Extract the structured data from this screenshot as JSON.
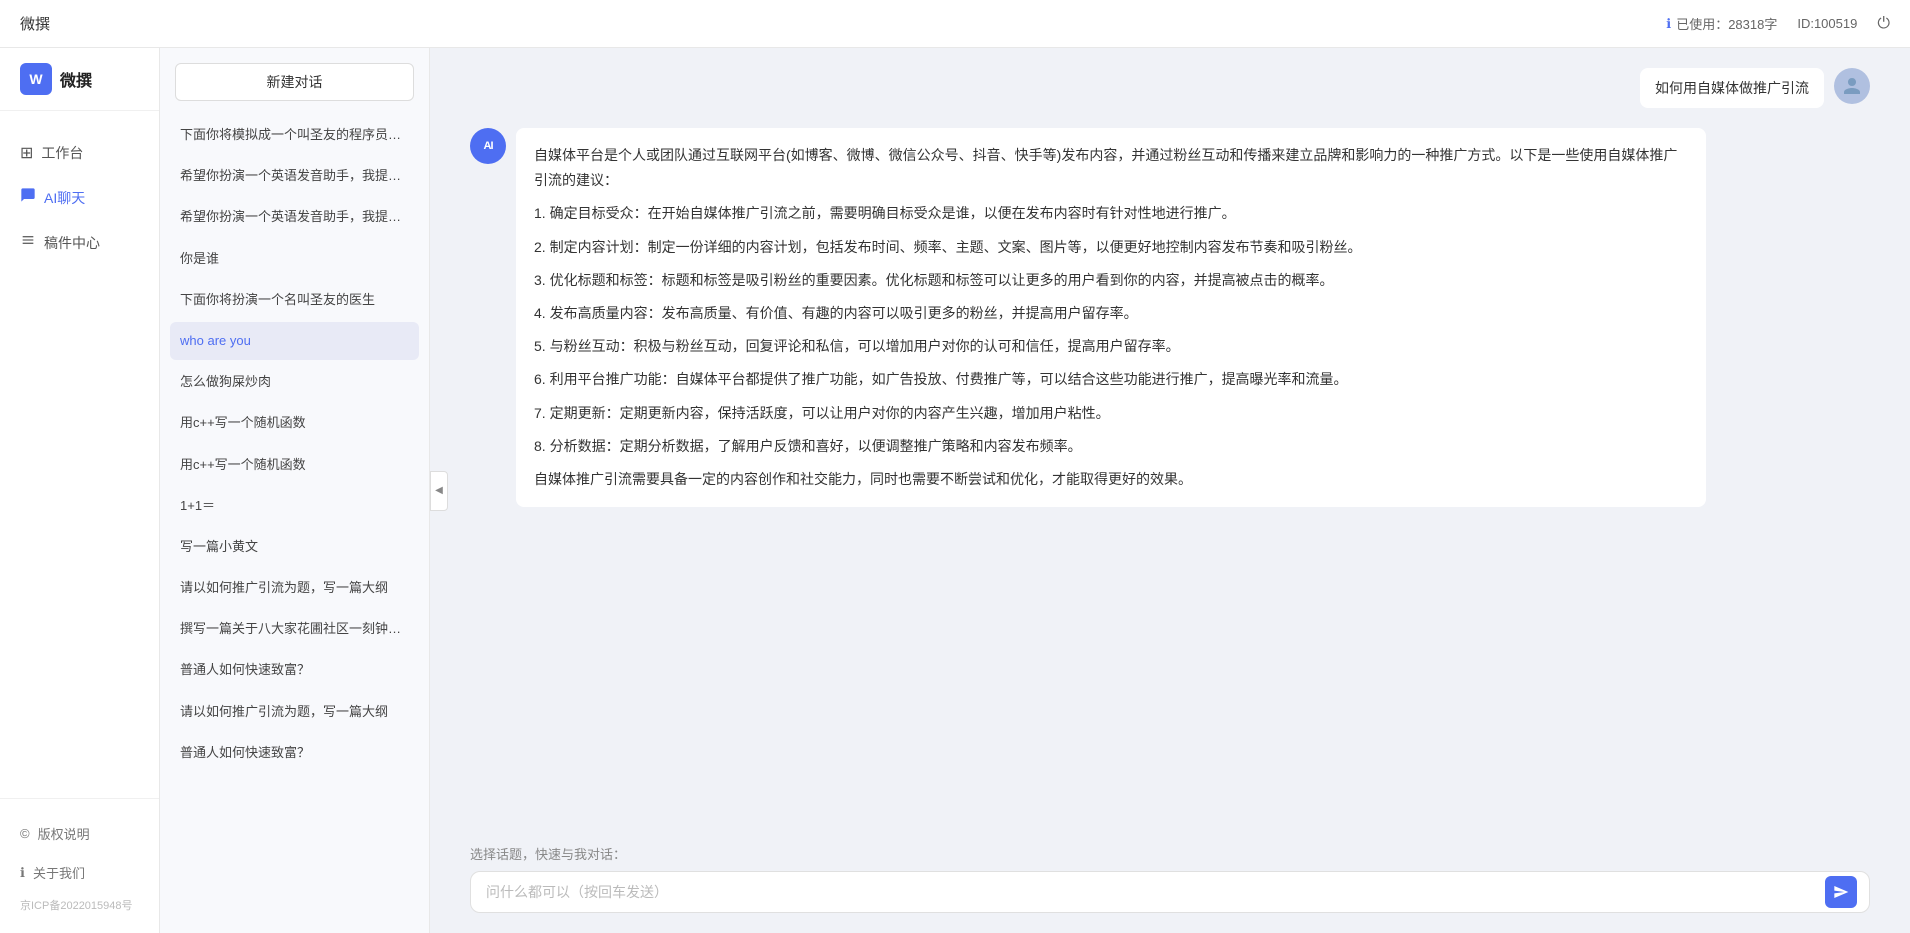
{
  "topbar": {
    "title": "微撰",
    "usage_label": "已使用：28318字",
    "usage_icon": "ℹ",
    "user_id_label": "ID:100519",
    "power_icon": "⏻"
  },
  "sidebar": {
    "logo_text": "微撰",
    "nav_items": [
      {
        "id": "workspace",
        "label": "工作台",
        "icon": "⊞"
      },
      {
        "id": "ai-chat",
        "label": "AI聊天",
        "icon": "💬",
        "active": true
      },
      {
        "id": "components",
        "label": "稿件中心",
        "icon": "📄"
      }
    ],
    "bottom_items": [
      {
        "id": "copyright",
        "label": "版权说明",
        "icon": "©"
      },
      {
        "id": "about",
        "label": "关于我们",
        "icon": "ℹ"
      }
    ],
    "icp": "京ICP备2022015948号"
  },
  "conv_panel": {
    "new_btn_label": "新建对话",
    "conversations": [
      {
        "id": 1,
        "text": "下面你将模拟成一个叫圣友的程序员，我说..."
      },
      {
        "id": 2,
        "text": "希望你扮演一个英语发音助手，我提供给你..."
      },
      {
        "id": 3,
        "text": "希望你扮演一个英语发音助手，我提供给你..."
      },
      {
        "id": 4,
        "text": "你是谁"
      },
      {
        "id": 5,
        "text": "下面你将扮演一个名叫圣友的医生"
      },
      {
        "id": 6,
        "text": "who are you"
      },
      {
        "id": 7,
        "text": "怎么做狗屎炒肉"
      },
      {
        "id": 8,
        "text": "用c++写一个随机函数"
      },
      {
        "id": 9,
        "text": "用c++写一个随机函数"
      },
      {
        "id": 10,
        "text": "1+1＝"
      },
      {
        "id": 11,
        "text": "写一篇小黄文"
      },
      {
        "id": 12,
        "text": "请以如何推广引流为题，写一篇大纲"
      },
      {
        "id": 13,
        "text": "撰写一篇关于八大家花圃社区一刻钟便民生..."
      },
      {
        "id": 14,
        "text": "普通人如何快速致富？"
      },
      {
        "id": 15,
        "text": "请以如何推广引流为题，写一篇大纲"
      },
      {
        "id": 16,
        "text": "普通人如何快速致富？"
      }
    ]
  },
  "chat": {
    "user_avatar_icon": "👤",
    "ai_avatar_text": "AI",
    "messages": [
      {
        "type": "user",
        "text": "如何用自媒体做推广引流"
      },
      {
        "type": "ai",
        "paragraphs": [
          "自媒体平台是个人或团队通过互联网平台(如博客、微博、微信公众号、抖音、快手等)发布内容，并通过粉丝互动和传播来建立品牌和影响力的一种推广方式。以下是一些使用自媒体推广引流的建议：",
          "1. 确定目标受众：在开始自媒体推广引流之前，需要明确目标受众是谁，以便在发布内容时有针对性地进行推广。",
          "2. 制定内容计划：制定一份详细的内容计划，包括发布时间、频率、主题、文案、图片等，以便更好地控制内容发布节奏和吸引粉丝。",
          "3. 优化标题和标签：标题和标签是吸引粉丝的重要因素。优化标题和标签可以让更多的用户看到你的内容，并提高被点击的概率。",
          "4. 发布高质量内容：发布高质量、有价值、有趣的内容可以吸引更多的粉丝，并提高用户留存率。",
          "5. 与粉丝互动：积极与粉丝互动，回复评论和私信，可以增加用户对你的认可和信任，提高用户留存率。",
          "6. 利用平台推广功能：自媒体平台都提供了推广功能，如广告投放、付费推广等，可以结合这些功能进行推广，提高曝光率和流量。",
          "7. 定期更新：定期更新内容，保持活跃度，可以让用户对你的内容产生兴趣，增加用户粘性。",
          "8. 分析数据：定期分析数据，了解用户反馈和喜好，以便调整推广策略和内容发布频率。",
          "自媒体推广引流需要具备一定的内容创作和社交能力，同时也需要不断尝试和优化，才能取得更好的效果。"
        ]
      }
    ],
    "quick_topics_label": "选择话题，快速与我对话：",
    "input_placeholder": "问什么都可以（按回车发送）",
    "send_icon": "▶"
  },
  "collapse_icon": "◀"
}
